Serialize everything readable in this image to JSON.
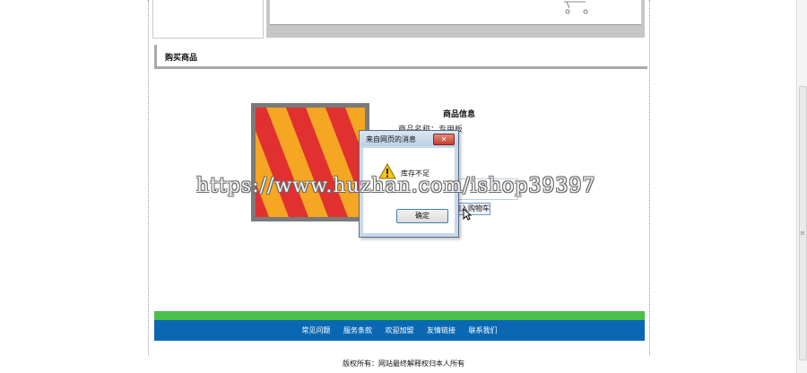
{
  "section": {
    "title": "购买商品"
  },
  "product": {
    "info_title": "商品信息",
    "info_line": "商品名称：专用板",
    "buy_button": "加入购物车"
  },
  "dialog": {
    "title": "来自网页的消息",
    "close_label": "✕",
    "message": "库存不足",
    "ok_button": "确定"
  },
  "watermark": "https://www.huzhan.com/ishop39397",
  "footer": {
    "nav": [
      "常见问题",
      "服务条款",
      "欢迎加盟",
      "友情链接",
      "联系我们"
    ],
    "copyright": "版权所有：网站最终解释权归本人所有"
  },
  "colors": {
    "green_bar": "#4cbe4a",
    "blue_bar": "#0a68b3",
    "stripe_red": "#e03030",
    "stripe_yellow": "#f5a623"
  },
  "icons": [
    "cart-icon",
    "warning-icon",
    "close-icon",
    "mouse-cursor-icon",
    "scroll-grip-icon"
  ]
}
